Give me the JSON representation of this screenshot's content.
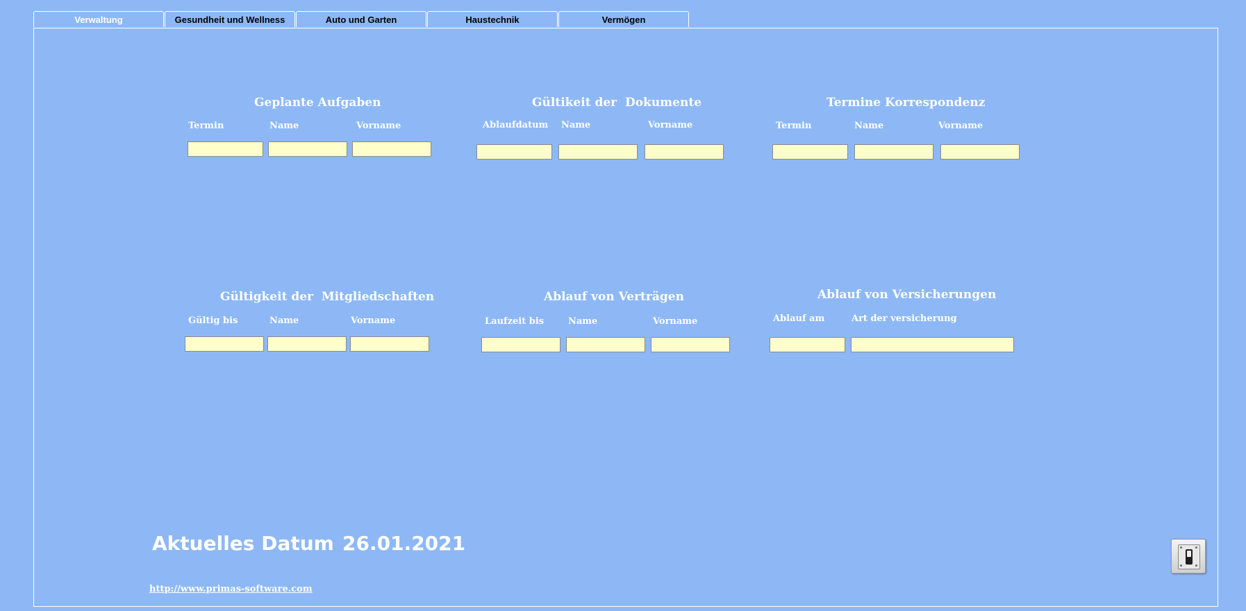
{
  "tabs": [
    {
      "label": "Verwaltung",
      "active": true
    },
    {
      "label": "Gesundheit und Wellness",
      "active": false
    },
    {
      "label": "Auto und Garten",
      "active": false
    },
    {
      "label": "Haustechnik",
      "active": false
    },
    {
      "label": "Vermögen",
      "active": false
    }
  ],
  "sections": {
    "geplante_aufgaben": {
      "title": "Geplante Aufgaben",
      "columns": [
        "Termin",
        "Name",
        "Vorname"
      ],
      "values": [
        "",
        "",
        ""
      ]
    },
    "gueltigkeit_dokumente": {
      "title": "Gültikeit der  Dokumente",
      "columns": [
        "Ablaufdatum",
        "Name",
        "Vorname"
      ],
      "values": [
        "",
        "",
        ""
      ]
    },
    "termine_korrespondenz": {
      "title": "Termine Korrespondenz",
      "columns": [
        "Termin",
        "Name",
        "Vorname"
      ],
      "values": [
        "",
        "",
        ""
      ]
    },
    "gueltigkeit_mitgliedschaften": {
      "title": "Gültigkeit der  Mitgliedschaften",
      "columns": [
        "Gültig bis",
        "Name",
        "Vorname"
      ],
      "values": [
        "",
        "",
        ""
      ]
    },
    "ablauf_vertraege": {
      "title": "Ablauf von Verträgen",
      "columns": [
        "Laufzeit bis",
        "Name",
        "Vorname"
      ],
      "values": [
        "",
        "",
        ""
      ]
    },
    "ablauf_versicherungen": {
      "title": "Ablauf von Versicherungen",
      "columns": [
        "Ablauf am",
        "Art der versicherung"
      ],
      "values": [
        "",
        ""
      ]
    }
  },
  "current_date": {
    "label": "Aktuelles Datum",
    "value": "26.01.2021"
  },
  "website_link": "http://www.primas-software.com",
  "exit_button": {
    "icon": "light-switch-icon"
  },
  "colors": {
    "background": "#8db8f5",
    "field": "#ffffcc",
    "text": "#ffffff"
  }
}
